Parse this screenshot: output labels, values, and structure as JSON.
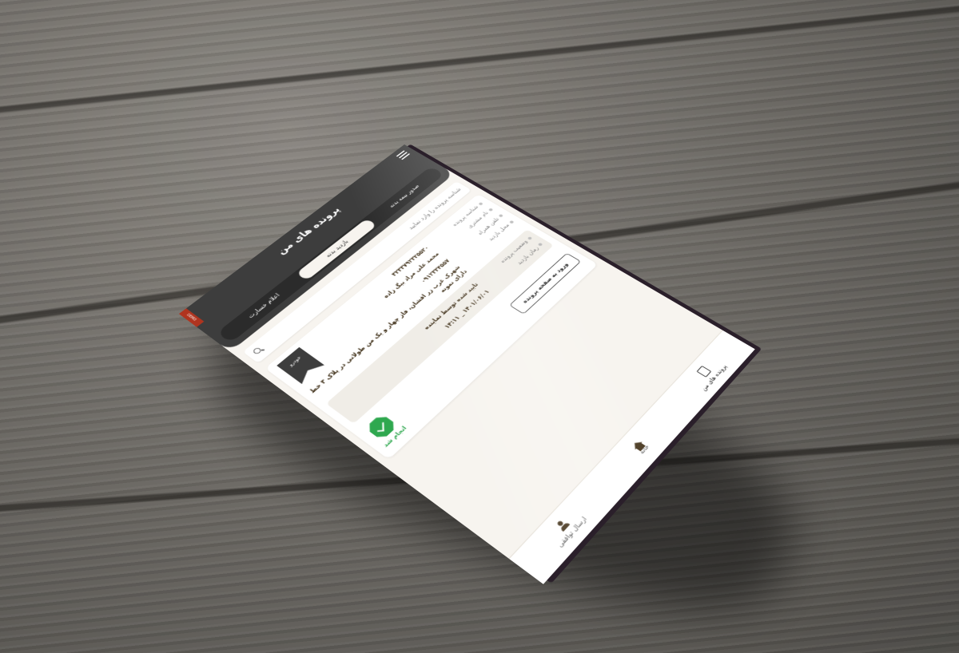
{
  "app": {
    "title": "پرونده های من",
    "demo_ribbon": "DEMO"
  },
  "tabs": [
    {
      "label": "اعلام خسارت"
    },
    {
      "label": "بازدید بدنه"
    },
    {
      "label": "صدور بیمه بدنه"
    }
  ],
  "search": {
    "placeholder": "شناسه پرونده را وارد نمایید"
  },
  "case_card": {
    "badge": "خودرو",
    "fields": [
      {
        "label": "شناسه پرونده",
        "value": "۳۲۳۳۷۹۲۳۲۵۵۲۰"
      },
      {
        "label": "نام مشتری",
        "value": "محمد علی مراد بیگ زاده"
      },
      {
        "label": "تلفن همراه",
        "value": "۰۹۱۲۳۳۴۵۵۷"
      },
      {
        "label": "محل بازدید",
        "value": "شهرک غرب زر افشان، فاز چهار و یک من طولانی در پلاک ۳ خط دارای نمونه"
      }
    ],
    "status": {
      "status_label": "وضعیت پرونده",
      "status_value": "تایید شده توسط نماینده",
      "time_label": "زمان بازدید",
      "time_value": "۱۴۰۱/۰۶/۰۱ _ ۱۴:۱۱"
    },
    "open_button": "ورود به صفحه پرونده",
    "done_label": "انجام شد"
  },
  "bottom_nav": [
    {
      "label": "پرونده های من",
      "icon": "files-icon"
    },
    {
      "label": "خانه",
      "icon": "home-icon"
    },
    {
      "label": "ارسال توافقی",
      "icon": "people-icon"
    }
  ],
  "colors": {
    "header": "#3d3d3d",
    "background": "#f7f4ef",
    "success": "#2fa84f",
    "ribbon": "#b0341f"
  }
}
